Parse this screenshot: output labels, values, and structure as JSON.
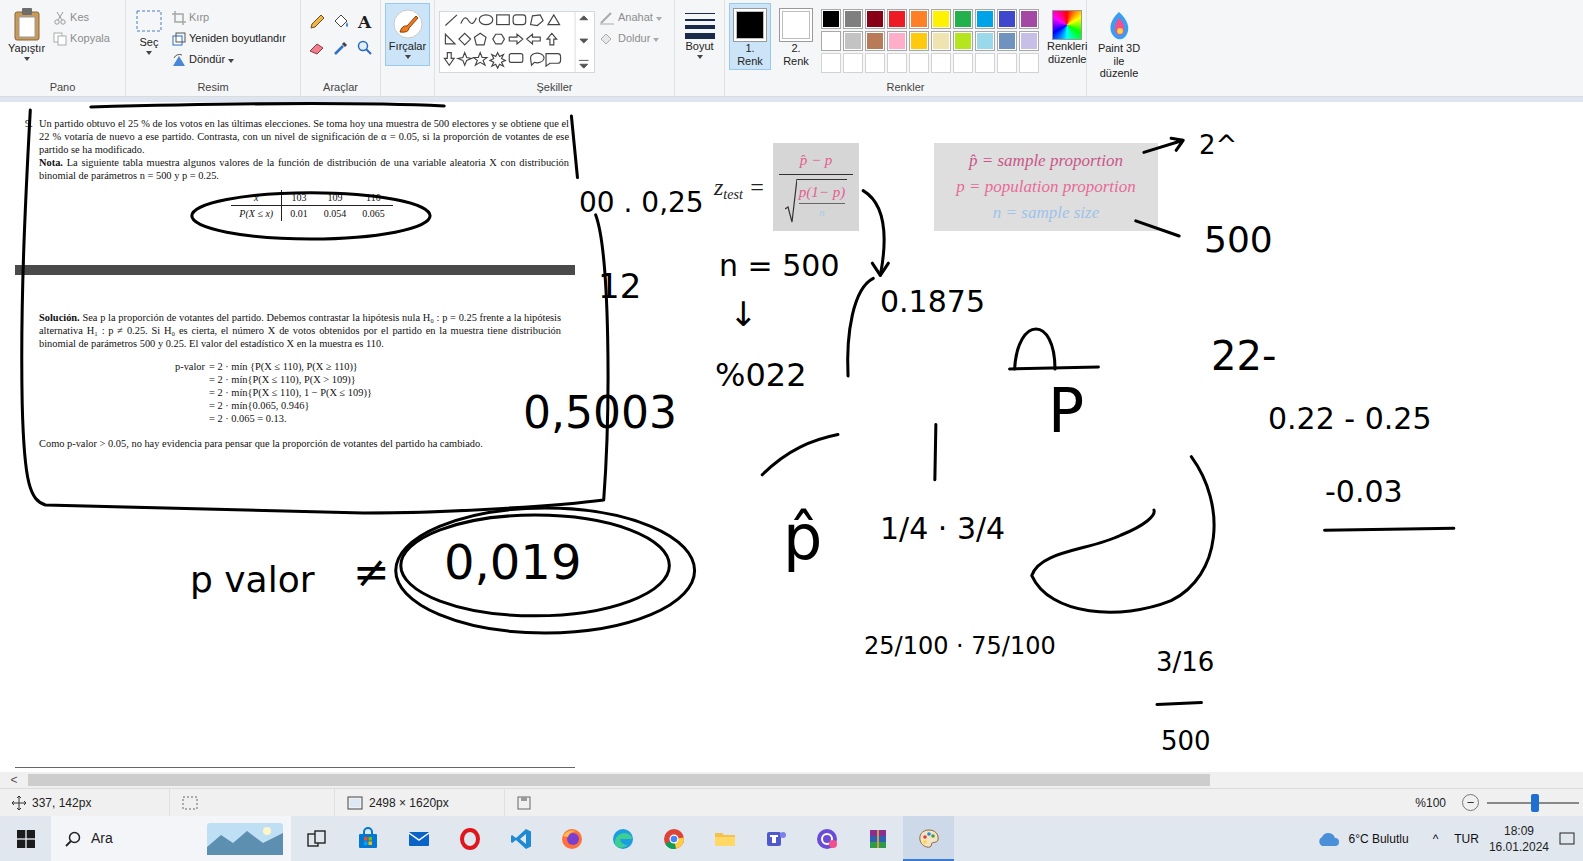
{
  "ribbon": {
    "clipboard": {
      "label": "Pano",
      "paste": {
        "label": "Yapıştır"
      },
      "cut": {
        "label": "Kes",
        "disabled": true
      },
      "copy": {
        "label": "Kopyala",
        "disabled": true
      }
    },
    "image": {
      "label": "Resim",
      "select": {
        "label": "Seç"
      },
      "crop": {
        "label": "Kırp",
        "disabled": true
      },
      "resize": {
        "label": "Yeniden boyutlandır",
        "disabled": false
      },
      "rotate": {
        "label": "Döndür",
        "disabled": false
      }
    },
    "tools": {
      "label": "Araçlar",
      "text_tool": "A"
    },
    "brushes": {
      "label": "Fırçalar",
      "selected": true
    },
    "shapes": {
      "label": "Şekiller",
      "outline": {
        "label": "Anahat",
        "disabled": true
      },
      "fill": {
        "label": "Doldur",
        "disabled": true
      }
    },
    "size": {
      "label": "Boyut"
    },
    "colors": {
      "label": "Renkler",
      "slots": [
        {
          "label": "1. Renk",
          "selected": true,
          "color": "#000000"
        },
        {
          "label": "2. Renk",
          "selected": false,
          "color": "#ffffff"
        }
      ],
      "swatches": [
        {
          "color": "#000000"
        },
        {
          "color": "#7f7f7f"
        },
        {
          "color": "#880015"
        },
        {
          "color": "#ed1c24"
        },
        {
          "color": "#ff7f27"
        },
        {
          "color": "#fff200"
        },
        {
          "color": "#22b14c"
        },
        {
          "color": "#00a2e8"
        },
        {
          "color": "#3f48cc"
        },
        {
          "color": "#a349a4"
        },
        {
          "color": "#ffffff"
        },
        {
          "color": "#c3c3c3"
        },
        {
          "color": "#b97a57"
        },
        {
          "color": "#ffaec9"
        },
        {
          "color": "#ffc90e"
        },
        {
          "color": "#efe4b0"
        },
        {
          "color": "#b5e61d"
        },
        {
          "color": "#99d9ea"
        },
        {
          "color": "#7092be"
        },
        {
          "color": "#c8bfe7"
        }
      ],
      "edit": {
        "label": "Renkleri düzenle"
      }
    },
    "paint3d": {
      "label": "Paint 3D ile düzenle"
    }
  },
  "document": {
    "problem": {
      "number": "9.",
      "text": "Un partido obtuvo el 25 % de los votos en las últimas elecciones. Se toma hoy una muestra de 500 electores y se obtiene que el 22 % votaría de nuevo a ese partido. Contrasta, con un nivel de significación de α = 0.05, si la proporción de votantes de ese partido se ha modificado."
    },
    "note": {
      "label": "Nota.",
      "text": "La siguiente tabla muestra algunos valores de la función de distribución de una variable aleatoria X con distribución binomial de parámetros n = 500 y p = 0.25."
    },
    "table": {
      "header": [
        "x",
        "103",
        "109",
        "110"
      ],
      "row": [
        "P(X ≤ x)",
        "0.01",
        "0.054",
        "0.065"
      ]
    },
    "solution": {
      "label": "Solución.",
      "text": "Sea p la proporción de votantes del partido. Debemos contrastar la hipótesis nula H₀ : p = 0.25 frente a la hipótesis alternativa H₁ : p ≠ 0.25. Si H₀ es cierta, el número X de votos obtenidos por el partido en la muestra tiene distribución binomial de parámetros 500 y 0.25. El valor del estadístico X en la muestra es 110."
    },
    "pvalue": {
      "label": "p-valor",
      "lines": [
        "= 2 · mín {P(X ≤ 110), P(X ≥ 110)}",
        "= 2 · mín{P(X ≤ 110), P(X > 109)}",
        "= 2 · mín{P(X ≤ 110), 1 − P(X ≤ 109)}",
        "= 2 · mín{0.065, 0.946}",
        "= 2 · 0.065 = 0.13."
      ]
    },
    "conclusion": "Como p-valor > 0.05, no hay evidencia para pensar que la proporción de votantes del partido ha cambiado."
  },
  "formula": {
    "lhs": "z",
    "lhs_sub": "test",
    "equals": "=",
    "numerator": "p̂ − p",
    "radicand_top": "p(1− p)",
    "radicand_bottom": "n"
  },
  "legend": [
    {
      "text": "p̂ = sample proportion",
      "color": "#c9558a"
    },
    {
      "text": "p = population proportion",
      "color": "#e86a97"
    },
    {
      "text": "n = sample size",
      "color": "#9fc2ea"
    }
  ],
  "annotations": [
    {
      "text": "00 . 0,25"
    },
    {
      "text": "12"
    },
    {
      "text": "n = 500"
    },
    {
      "text": "↓"
    },
    {
      "text": "%022"
    },
    {
      "text": "0,5003"
    },
    {
      "text": "0.1875"
    },
    {
      "text": "P"
    },
    {
      "text": "2^"
    },
    {
      "text": "500"
    },
    {
      "text": "22-"
    },
    {
      "text": "0.22 - 0.25"
    },
    {
      "text": "-0.03"
    },
    {
      "text": "p̂"
    },
    {
      "text": "1/4 · 3/4"
    },
    {
      "text": "25/100 · 75/100"
    },
    {
      "text": "3/16"
    },
    {
      "text": "500"
    },
    {
      "text": "p valor"
    },
    {
      "text": "≠"
    },
    {
      "text": "0,019"
    }
  ],
  "scrollbar": {
    "arrow": "<",
    "level": 0.76
  },
  "status_bar": {
    "cursor": "337, 142px",
    "dimensions": "2498 × 1620px",
    "zoom": "%100",
    "zoom_out": "−",
    "zoom_level": 0.52
  },
  "taskbar": {
    "search": "Ara",
    "apps": [
      {
        "selected": false
      },
      {
        "selected": false
      },
      {
        "selected": false
      },
      {
        "selected": false
      },
      {
        "selected": false
      },
      {
        "selected": false
      },
      {
        "selected": false
      },
      {
        "selected": false
      },
      {
        "selected": false
      },
      {
        "selected": false
      },
      {
        "selected": false
      },
      {
        "selected": true
      }
    ],
    "weather": "6°C Bulutlu",
    "tray_chevron": "^",
    "language": "TUR",
    "time": "18:09",
    "date": "16.01.2024"
  }
}
